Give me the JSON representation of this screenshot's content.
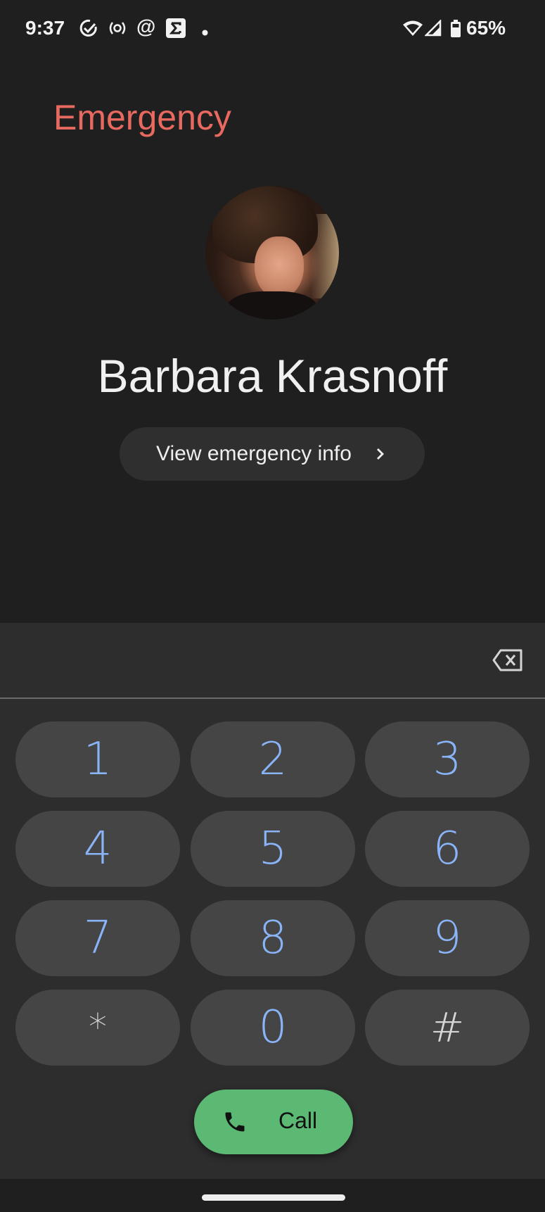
{
  "status_bar": {
    "time": "9:37",
    "left_icons": [
      "task-check-icon",
      "hotspot-icon",
      "at-sign-icon",
      "sigma-app-icon",
      "notification-dot-icon"
    ],
    "right_icons": [
      "wifi-icon",
      "cellular-signal-icon",
      "battery-icon"
    ],
    "battery_percent": "65%"
  },
  "header": {
    "mode_label": "Emergency",
    "mode_color": "#e8695f"
  },
  "contact": {
    "name": "Barbara Krasnoff",
    "avatar": "contact-photo"
  },
  "info_button": {
    "label": "View emergency info",
    "icon": "chevron-right-icon"
  },
  "dialpad": {
    "input_value": "",
    "backspace_icon": "backspace-icon",
    "keys": [
      {
        "label": "1"
      },
      {
        "label": "2"
      },
      {
        "label": "3"
      },
      {
        "label": "4"
      },
      {
        "label": "5"
      },
      {
        "label": "6"
      },
      {
        "label": "7"
      },
      {
        "label": "8"
      },
      {
        "label": "9"
      },
      {
        "label": "*"
      },
      {
        "label": "0"
      },
      {
        "label": "#"
      }
    ],
    "digit_color": "#8ab4f8"
  },
  "call_button": {
    "label": "Call",
    "icon": "phone-icon",
    "color": "#5bb974"
  },
  "nav_bar": {
    "handle": "home-gesture-handle"
  }
}
